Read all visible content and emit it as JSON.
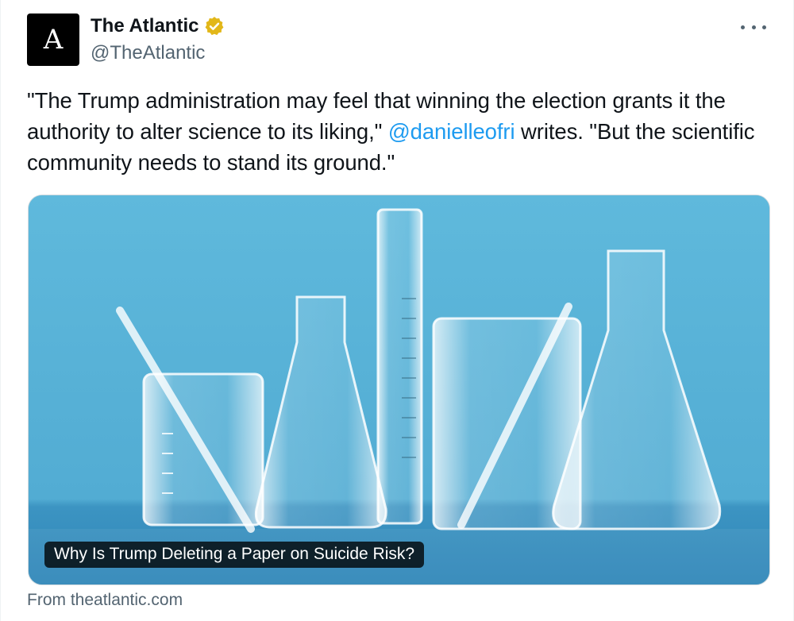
{
  "author": {
    "avatar_letter": "A",
    "display_name": "The Atlantic",
    "handle": "@TheAtlantic",
    "verified_icon": "gold-checkmark-badge"
  },
  "menu": {
    "icon": "more-horizontal-icon"
  },
  "tweet": {
    "text_part1": "\"The Trump administration may feel that winning the election grants it the authority to alter science to its liking,\" ",
    "mention": "@danielleofri",
    "text_part2": " writes. \"But the scientific community needs to stand its ground.\""
  },
  "link_card": {
    "image_description_icon": "lab-glassware-photo",
    "headline": "Why Is Trump Deleting a Paper on Suicide Risk?",
    "source": "From theatlantic.com"
  },
  "colors": {
    "accent": "#1d9bf0",
    "verified_gold": "#e2b719",
    "secondary_text": "#536471",
    "image_background": "#56b3d6"
  }
}
